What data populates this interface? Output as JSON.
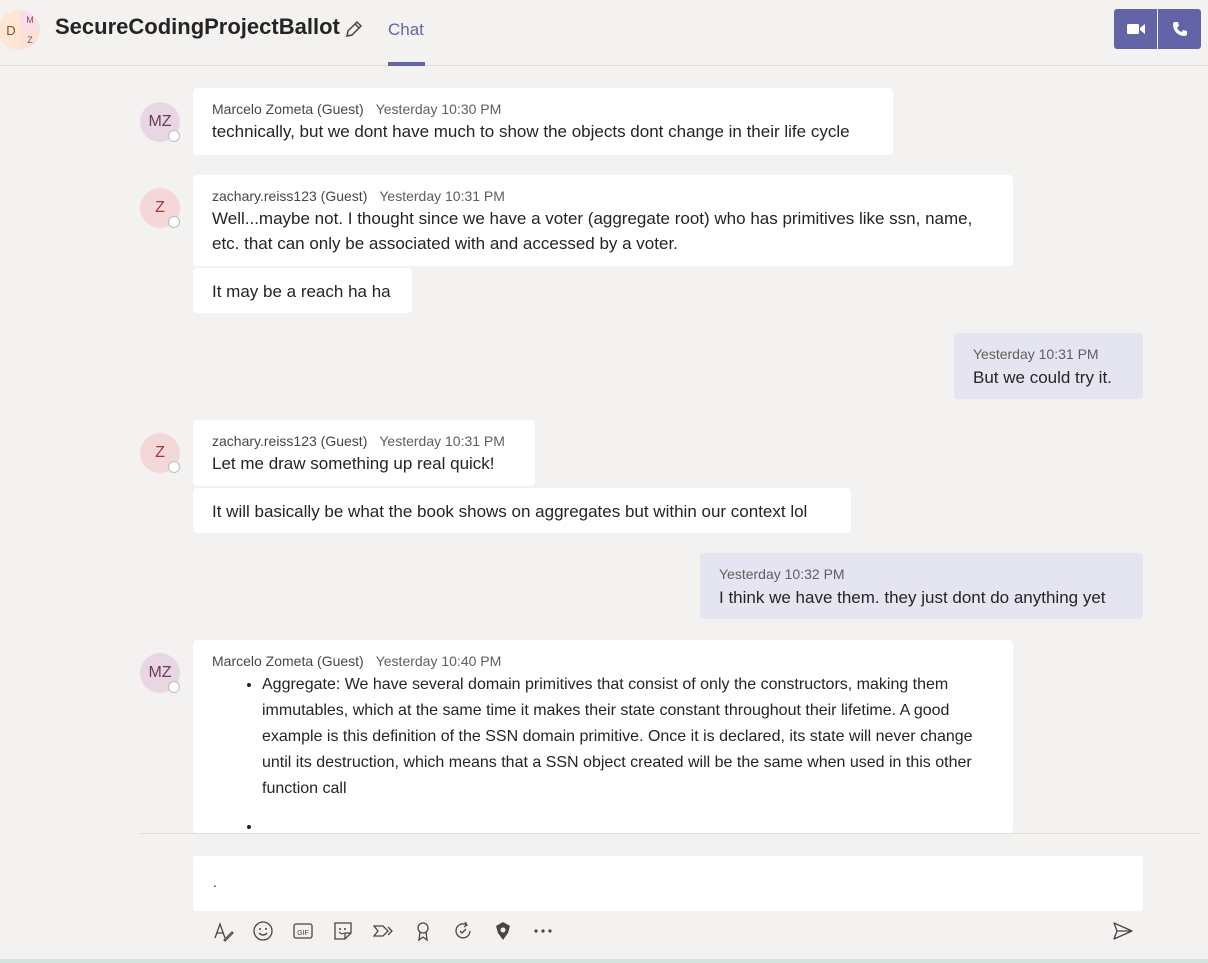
{
  "header": {
    "group_avatar": {
      "left": "D",
      "right_top": "M",
      "right_bottom": "Z"
    },
    "title": "SecureCodingProjectBallot",
    "tabs": [
      {
        "label": "Chat",
        "active": true
      }
    ],
    "accent": "#6264a7"
  },
  "messages": [
    {
      "author": "Marcelo Zometa (Guest)",
      "time": "Yesterday 10:30 PM",
      "initials": "MZ",
      "text": "technically, but we dont have much to show the objects dont change in their life cycle"
    },
    {
      "author": "zachary.reiss123 (Guest)",
      "time": "Yesterday 10:31 PM",
      "initials": "Z",
      "text": "Well...maybe not. I thought since we have a voter (aggregate root) who has primitives like ssn, name, etc. that can only be associated with and accessed by a voter."
    },
    {
      "text": "It may be a reach ha ha"
    },
    {
      "time": "Yesterday 10:31 PM",
      "text": "But we could try it.",
      "mine": true
    },
    {
      "author": "zachary.reiss123 (Guest)",
      "time": "Yesterday 10:31 PM",
      "initials": "Z",
      "text": "Let me draw something up real quick!"
    },
    {
      "text": "It will basically be what the book shows on aggregates but within our context lol"
    },
    {
      "time": "Yesterday 10:32 PM",
      "text": "I think we have them. they just dont do anything yet",
      "mine": true
    },
    {
      "author": "Marcelo Zometa (Guest)",
      "time": "Yesterday 10:40 PM",
      "initials": "MZ",
      "bullets": [
        "Aggregate: We have several domain primitives that consist of only the constructors, making them immutables, which at the same time it makes their state constant throughout their lifetime. A good example is this definition of the SSN domain primitive. Once it is declared, its state will never change until its destruction, which means that a SSN object created will be the same when used in this other function call",
        ""
      ]
    }
  ],
  "composer": {
    "value": ".",
    "toolbar": [
      "format-icon",
      "emoji-icon",
      "gif-icon",
      "sticker-icon",
      "meet-now-icon",
      "praise-icon",
      "loop-icon",
      "app-icon",
      "more-options-icon"
    ],
    "send_icon": "send-icon"
  }
}
